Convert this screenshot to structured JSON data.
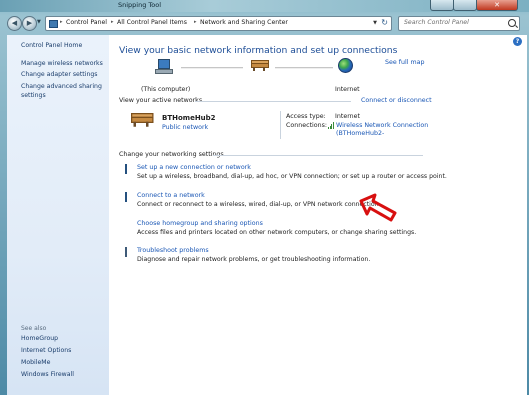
{
  "window": {
    "title": "Snipping Tool"
  },
  "address": {
    "crumbs": [
      "Control Panel",
      "All Control Panel Items",
      "Network and Sharing Center"
    ],
    "search_placeholder": "Search Control Panel"
  },
  "sidebar": {
    "home": "Control Panel Home",
    "items": [
      "Manage wireless networks",
      "Change adapter settings",
      "Change advanced sharing settings"
    ],
    "see_also_label": "See also",
    "see_also": [
      "HomeGroup",
      "Internet Options",
      "MobileMe",
      "Windows Firewall"
    ]
  },
  "main": {
    "title": "View your basic network information and set up connections",
    "see_full_map": "See full map",
    "map": {
      "computer": "(This computer)",
      "internet": "Internet"
    },
    "active_heading": "View your active networks",
    "connect_disconnect": "Connect or disconnect",
    "network": {
      "name": "BTHomeHub2",
      "type": "Public network",
      "access_type_label": "Access type:",
      "access_type": "Internet",
      "connections_label": "Connections:",
      "connection_line1": "Wireless Network Connection",
      "connection_line2": "(BTHomeHub2-"
    },
    "change_heading": "Change your networking settings",
    "tasks": [
      {
        "icon": "setup-connection-icon",
        "title": "Set up a new connection or network",
        "desc": "Set up a wireless, broadband, dial-up, ad hoc, or VPN connection; or set up a router or access point."
      },
      {
        "icon": "connect-network-icon",
        "title": "Connect to a network",
        "desc": "Connect or reconnect to a wireless, wired, dial-up, or VPN network connection."
      },
      {
        "icon": "homegroup-icon",
        "title": "Choose homegroup and sharing options",
        "desc": "Access files and printers located on other network computers, or change sharing settings."
      },
      {
        "icon": "troubleshoot-icon",
        "title": "Troubleshoot problems",
        "desc": "Diagnose and repair network problems, or get troubleshooting information."
      }
    ]
  },
  "colors": {
    "link": "#1a57b5",
    "title": "#1e4e97",
    "annotation_arrow": "#d81010"
  }
}
